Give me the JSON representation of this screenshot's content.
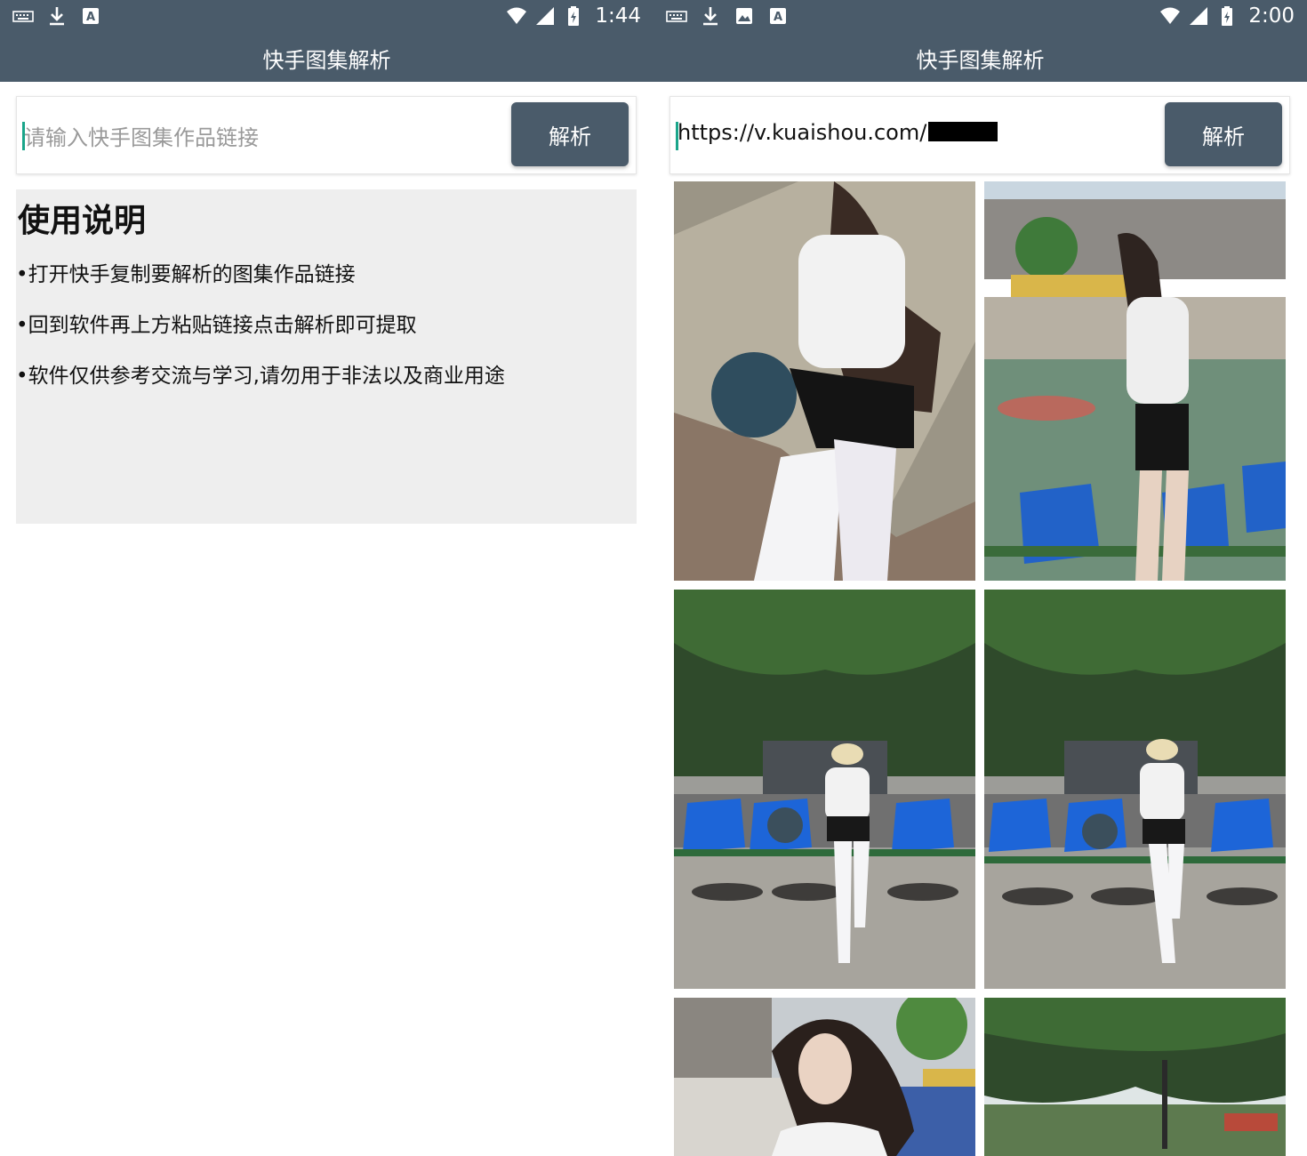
{
  "left": {
    "statusbar": {
      "time": "1:44",
      "icons": [
        "keyboard-icon",
        "download-icon",
        "text-icon",
        "wifi-icon",
        "signal-icon",
        "battery-icon"
      ]
    },
    "appbar": {
      "title": "快手图集解析"
    },
    "input": {
      "placeholder": "请输入快手图集作品链接",
      "value": ""
    },
    "parse_button": {
      "label": "解析"
    },
    "instructions": {
      "title": "使用说明",
      "items": [
        "•打开快手复制要解析的图集作品链接",
        "•回到软件再上方粘贴链接点击解析即可提取",
        "•软件仅供参考交流与学习,请勿用于非法以及商业用途"
      ]
    }
  },
  "right": {
    "statusbar": {
      "time": "2:00",
      "icons": [
        "keyboard-icon",
        "download-icon",
        "image-icon",
        "text-icon",
        "wifi-icon",
        "signal-icon",
        "battery-icon"
      ]
    },
    "appbar": {
      "title": "快手图集解析"
    },
    "input": {
      "value": "https://v.kuaishou.com/"
    },
    "parse_button": {
      "label": "解析"
    },
    "results": [
      {
        "name": "result-photo-1",
        "scene": "girl seated on stone bench with basketball"
      },
      {
        "name": "result-photo-2",
        "scene": "girl standing by court with blue seats"
      },
      {
        "name": "result-photo-3",
        "scene": "girl seated on blue stadium chairs under trees"
      },
      {
        "name": "result-photo-4",
        "scene": "girl seated on blue stadium chairs under trees"
      },
      {
        "name": "result-photo-5",
        "scene": "girl shading face near buildings"
      },
      {
        "name": "result-photo-6",
        "scene": "trees over court"
      }
    ]
  },
  "colors": {
    "bar": "#4a5b6a",
    "panel": "#eeeeee",
    "cursor": "#1aa58a"
  }
}
